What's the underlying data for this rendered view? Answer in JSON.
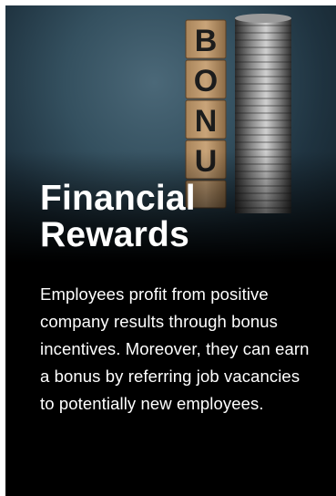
{
  "card": {
    "image_icon": "bonus-blocks-and-coins-image",
    "image_letters": [
      "B",
      "O",
      "N",
      "U"
    ],
    "title_line1": "Financial",
    "title_line2": "Rewards",
    "description": "Employees profit from positive company results through bonus incentives. Moreover, they can earn a bonus by referring job vacancies to potentially new employees."
  },
  "colors": {
    "background": "#000000",
    "text": "#ffffff",
    "page": "#ffffff"
  }
}
